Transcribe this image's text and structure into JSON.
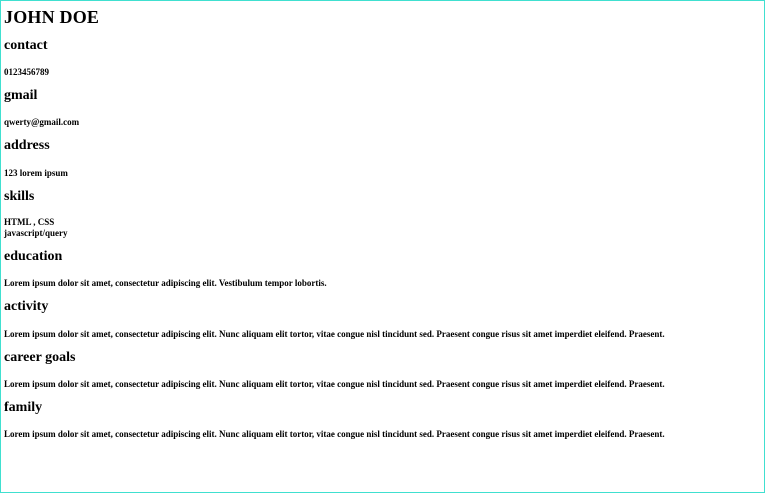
{
  "resume": {
    "name": "JOHN DOE",
    "contact": {
      "heading": "contact",
      "value": "0123456789"
    },
    "gmail": {
      "heading": "gmail",
      "value": "qwerty@gmail.com"
    },
    "address": {
      "heading": "address",
      "value": "123 lorem ipsum"
    },
    "skills": {
      "heading": "skills",
      "line1": "HTML , CSS",
      "line2": "javascript/query"
    },
    "education": {
      "heading": "education",
      "value": "Lorem ipsum dolor sit amet, consectetur adipiscing elit. Vestibulum tempor lobortis."
    },
    "activity": {
      "heading": "activity",
      "value": "Lorem ipsum dolor sit amet, consectetur adipiscing elit. Nunc aliquam elit tortor, vitae congue nisl tincidunt sed. Praesent congue risus sit amet imperdiet eleifend. Praesent."
    },
    "career_goals": {
      "heading": "career goals",
      "value": "Lorem ipsum dolor sit amet, consectetur adipiscing elit. Nunc aliquam elit tortor, vitae congue nisl tincidunt sed. Praesent congue risus sit amet imperdiet eleifend. Praesent."
    },
    "family": {
      "heading": "family",
      "value": "Lorem ipsum dolor sit amet, consectetur adipiscing elit. Nunc aliquam elit tortor, vitae congue nisl tincidunt sed. Praesent congue risus sit amet imperdiet eleifend. Praesent."
    }
  },
  "colors": {
    "frame_border": "#40e0d0",
    "text": "#000000",
    "background": "#ffffff"
  }
}
